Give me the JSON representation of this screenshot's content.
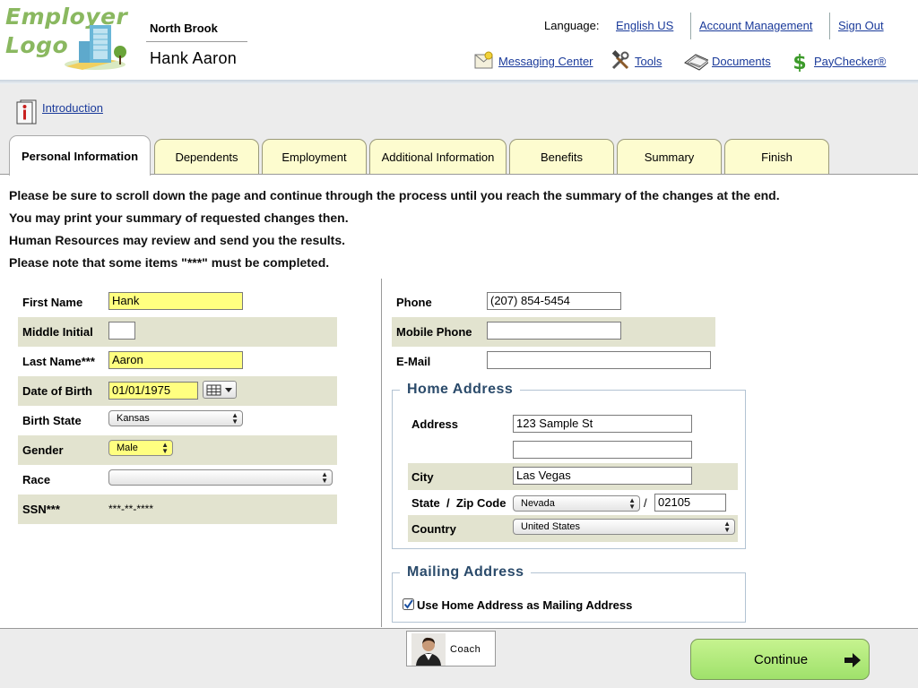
{
  "header": {
    "logo_line1": "Employer",
    "logo_line2": "Logo",
    "company": "North Brook",
    "person": "Hank Aaron",
    "language_label": "Language:",
    "language_link": "English US",
    "account_link": "Account Management",
    "signout_link": "Sign Out",
    "nav": {
      "messaging": "Messaging Center",
      "tools": "Tools",
      "documents": "Documents",
      "paychecker": "PayChecker®"
    }
  },
  "intro": {
    "link": "Introduction"
  },
  "tabs": [
    {
      "label": "Personal Information",
      "active": true
    },
    {
      "label": "Dependents"
    },
    {
      "label": "Employment"
    },
    {
      "label": "Additional Information"
    },
    {
      "label": "Benefits"
    },
    {
      "label": "Summary"
    },
    {
      "label": "Finish"
    }
  ],
  "instructions": [
    "Please be sure to scroll down the page and continue through the process until you reach the summary of the changes at the end.",
    "You may print your summary of requested changes then.",
    "Human Resources may review and send you the results.",
    "Please note that some items \"***\" must be completed."
  ],
  "personal": {
    "first_name": {
      "label": "First Name",
      "value": "Hank"
    },
    "middle_initial": {
      "label": "Middle Initial",
      "value": ""
    },
    "last_name": {
      "label": "Last Name***",
      "value": "Aaron"
    },
    "dob": {
      "label": "Date of Birth",
      "value": "01/01/1975"
    },
    "birth_state": {
      "label": "Birth State",
      "value": "Kansas"
    },
    "gender": {
      "label": "Gender",
      "value": "Male"
    },
    "race": {
      "label": "Race",
      "value": ""
    },
    "ssn": {
      "label": "SSN***",
      "value": "***-**-****"
    }
  },
  "contact": {
    "phone": {
      "label": "Phone",
      "value": "(207) 854-5454"
    },
    "mobile": {
      "label": "Mobile Phone",
      "value": ""
    },
    "email": {
      "label": "E-Mail",
      "value": ""
    }
  },
  "home_address": {
    "legend": "Home Address",
    "address_label": "Address",
    "address1": "123 Sample St",
    "address2": "",
    "city_label": "City",
    "city": "Las Vegas",
    "state_zip_label": "State  /  Zip Code",
    "state": "Nevada",
    "slash": "/",
    "zip": "02105",
    "country_label": "Country",
    "country": "United States"
  },
  "mailing_address": {
    "legend": "Mailing Address",
    "checkbox_label": "Use Home Address as Mailing Address",
    "checked": true
  },
  "footer": {
    "coach": "Coach",
    "continue": "Continue"
  },
  "colors": {
    "tab_bg": "#fdfccf",
    "required_field": "#ffff80",
    "row_shade": "#e2e3cf",
    "continue_green": "#b3ea7d",
    "link_blue": "#1a3a9a"
  }
}
